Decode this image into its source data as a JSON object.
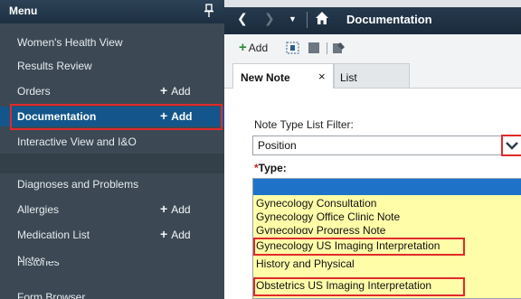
{
  "menu": {
    "title": "Menu",
    "items": [
      {
        "label": "Women's Health View",
        "add": ""
      },
      {
        "label": "Results Review",
        "add": ""
      },
      {
        "label": "Orders",
        "add": "Add"
      },
      {
        "label": "Documentation",
        "add": "Add"
      },
      {
        "label": "Interactive View and I&O",
        "add": ""
      },
      {
        "label": "Diagnoses and Problems",
        "add": ""
      },
      {
        "label": "Allergies",
        "add": "Add"
      },
      {
        "label": "Medication List",
        "add": "Add"
      },
      {
        "label": "Notes",
        "add": ""
      },
      {
        "label": "Histories",
        "add": ""
      },
      {
        "label": "Form Browser",
        "add": ""
      }
    ]
  },
  "nav": {
    "title": "Documentation"
  },
  "toolbar": {
    "add_label": "Add"
  },
  "tabs": {
    "new_note": "New Note",
    "close": "×",
    "list": "List"
  },
  "form": {
    "filter_label": "Note Type List Filter:",
    "filter_value": "Position",
    "type_required_mark": "*",
    "type_label": "Type:",
    "type_items": [
      "Gynecology Consultation",
      "Gynecology Office Clinic Note",
      "Gynecology Progress Note",
      "Gynecology US Imaging Interpretation",
      "History and Physical",
      "Obstetrics US Imaging Interpretation"
    ]
  },
  "colors": {
    "highlight_red": "#e02a2a",
    "menu_bg": "#3c4954",
    "selected_blue": "#14568c",
    "list_yellow": "#fffda8"
  }
}
